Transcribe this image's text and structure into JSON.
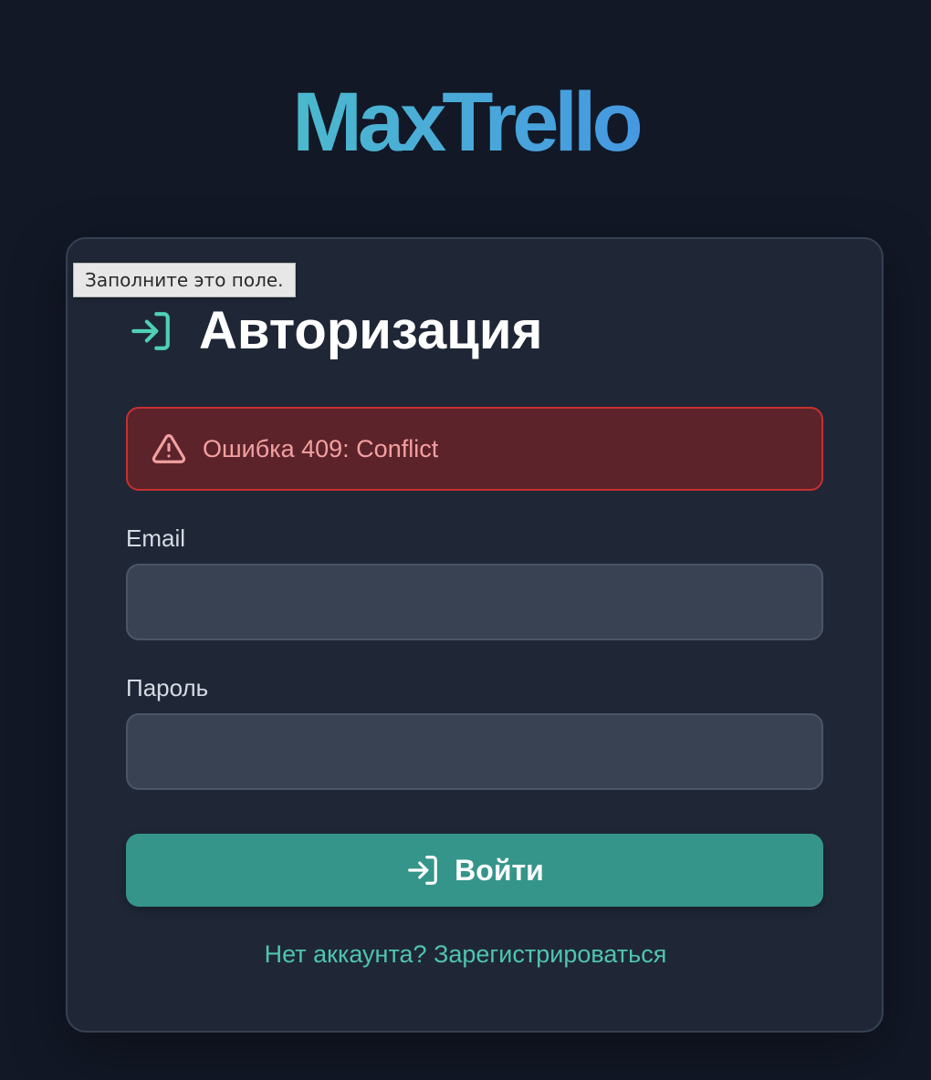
{
  "app": {
    "logo": "MaxTrello"
  },
  "tooltip": {
    "text": "Заполните это поле."
  },
  "form": {
    "title": "Авторизация",
    "title_icon": "login-icon",
    "error": {
      "icon": "warning-icon",
      "text": "Ошибка 409: Conflict"
    },
    "email": {
      "label": "Email",
      "value": "",
      "placeholder": ""
    },
    "password": {
      "label": "Пароль",
      "value": "",
      "placeholder": ""
    },
    "submit": {
      "icon": "login-icon",
      "label": "Войти"
    },
    "register_link": "Нет аккаунта? Зарегистрироваться"
  },
  "colors": {
    "background": "#121826",
    "card": "#1f2736",
    "accent": "#35958a",
    "link": "#4fc4b1",
    "error_bg": "#5c232b",
    "error_border": "#c7302f",
    "error_text": "#f2a09f",
    "logo_gradient_start": "#4fd1b5",
    "logo_gradient_end": "#3f7cf0"
  }
}
